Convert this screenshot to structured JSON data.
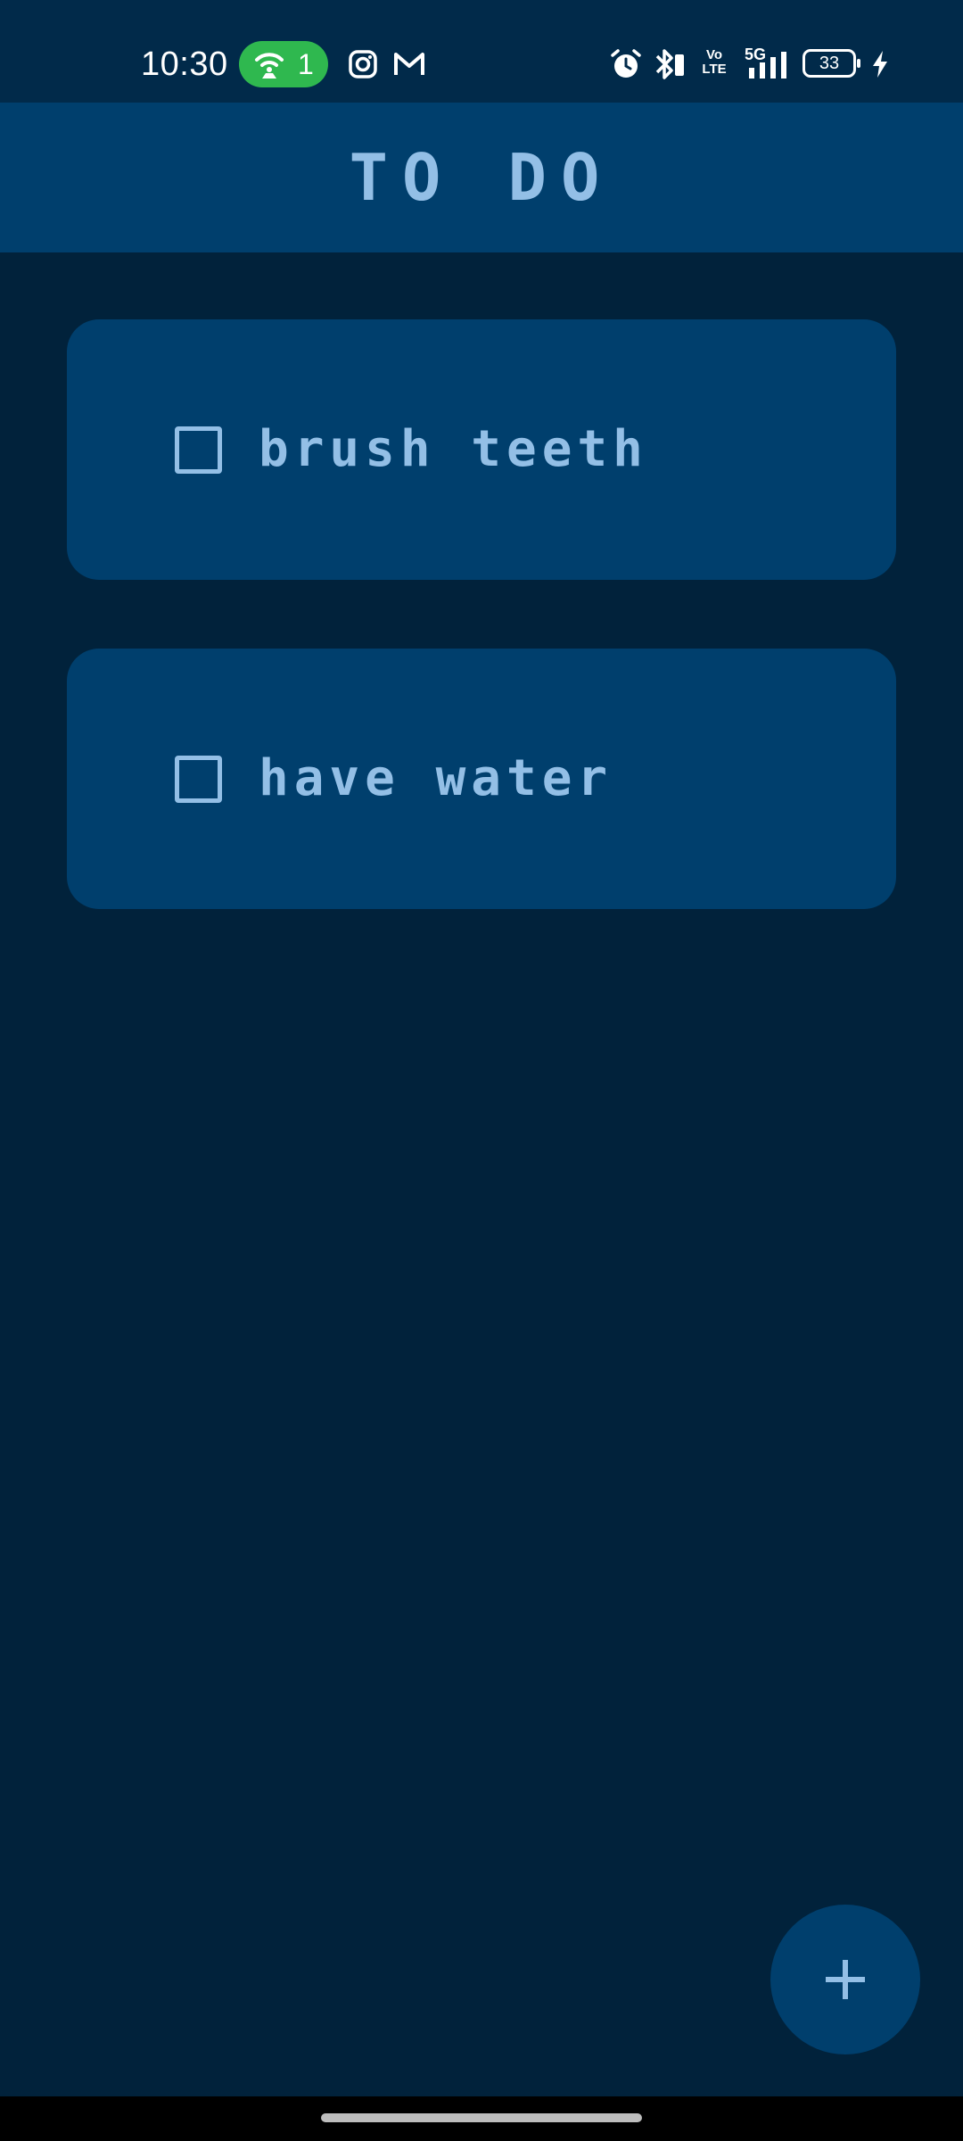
{
  "status_bar": {
    "time": "10:30",
    "hotspot_count": "1",
    "battery_level": "33",
    "network_type": "5G",
    "volte_top": "Vo",
    "volte_bottom": "LTE"
  },
  "app": {
    "title": "TO DO"
  },
  "tasks": [
    {
      "label": "brush teeth",
      "checked": false
    },
    {
      "label": "have water",
      "checked": false
    }
  ],
  "fab": {
    "icon": "plus-icon"
  },
  "colors": {
    "background": "#01223b",
    "header": "#003f6d",
    "card": "#003f6d",
    "text": "#93bfe6",
    "hotspot": "#2fb84f"
  }
}
